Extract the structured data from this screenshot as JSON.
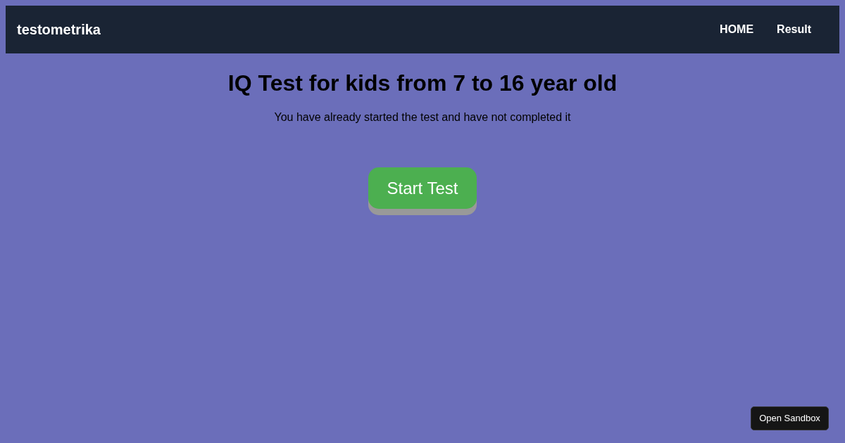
{
  "header": {
    "logo": "testometrika",
    "nav": [
      {
        "label": "HOME"
      },
      {
        "label": "Result"
      }
    ]
  },
  "main": {
    "title": "IQ Test for kids from 7 to 16 year old",
    "message": "You have already started the test and have not completed it",
    "start_button": "Start Test"
  },
  "sandbox_button": "Open Sandbox"
}
